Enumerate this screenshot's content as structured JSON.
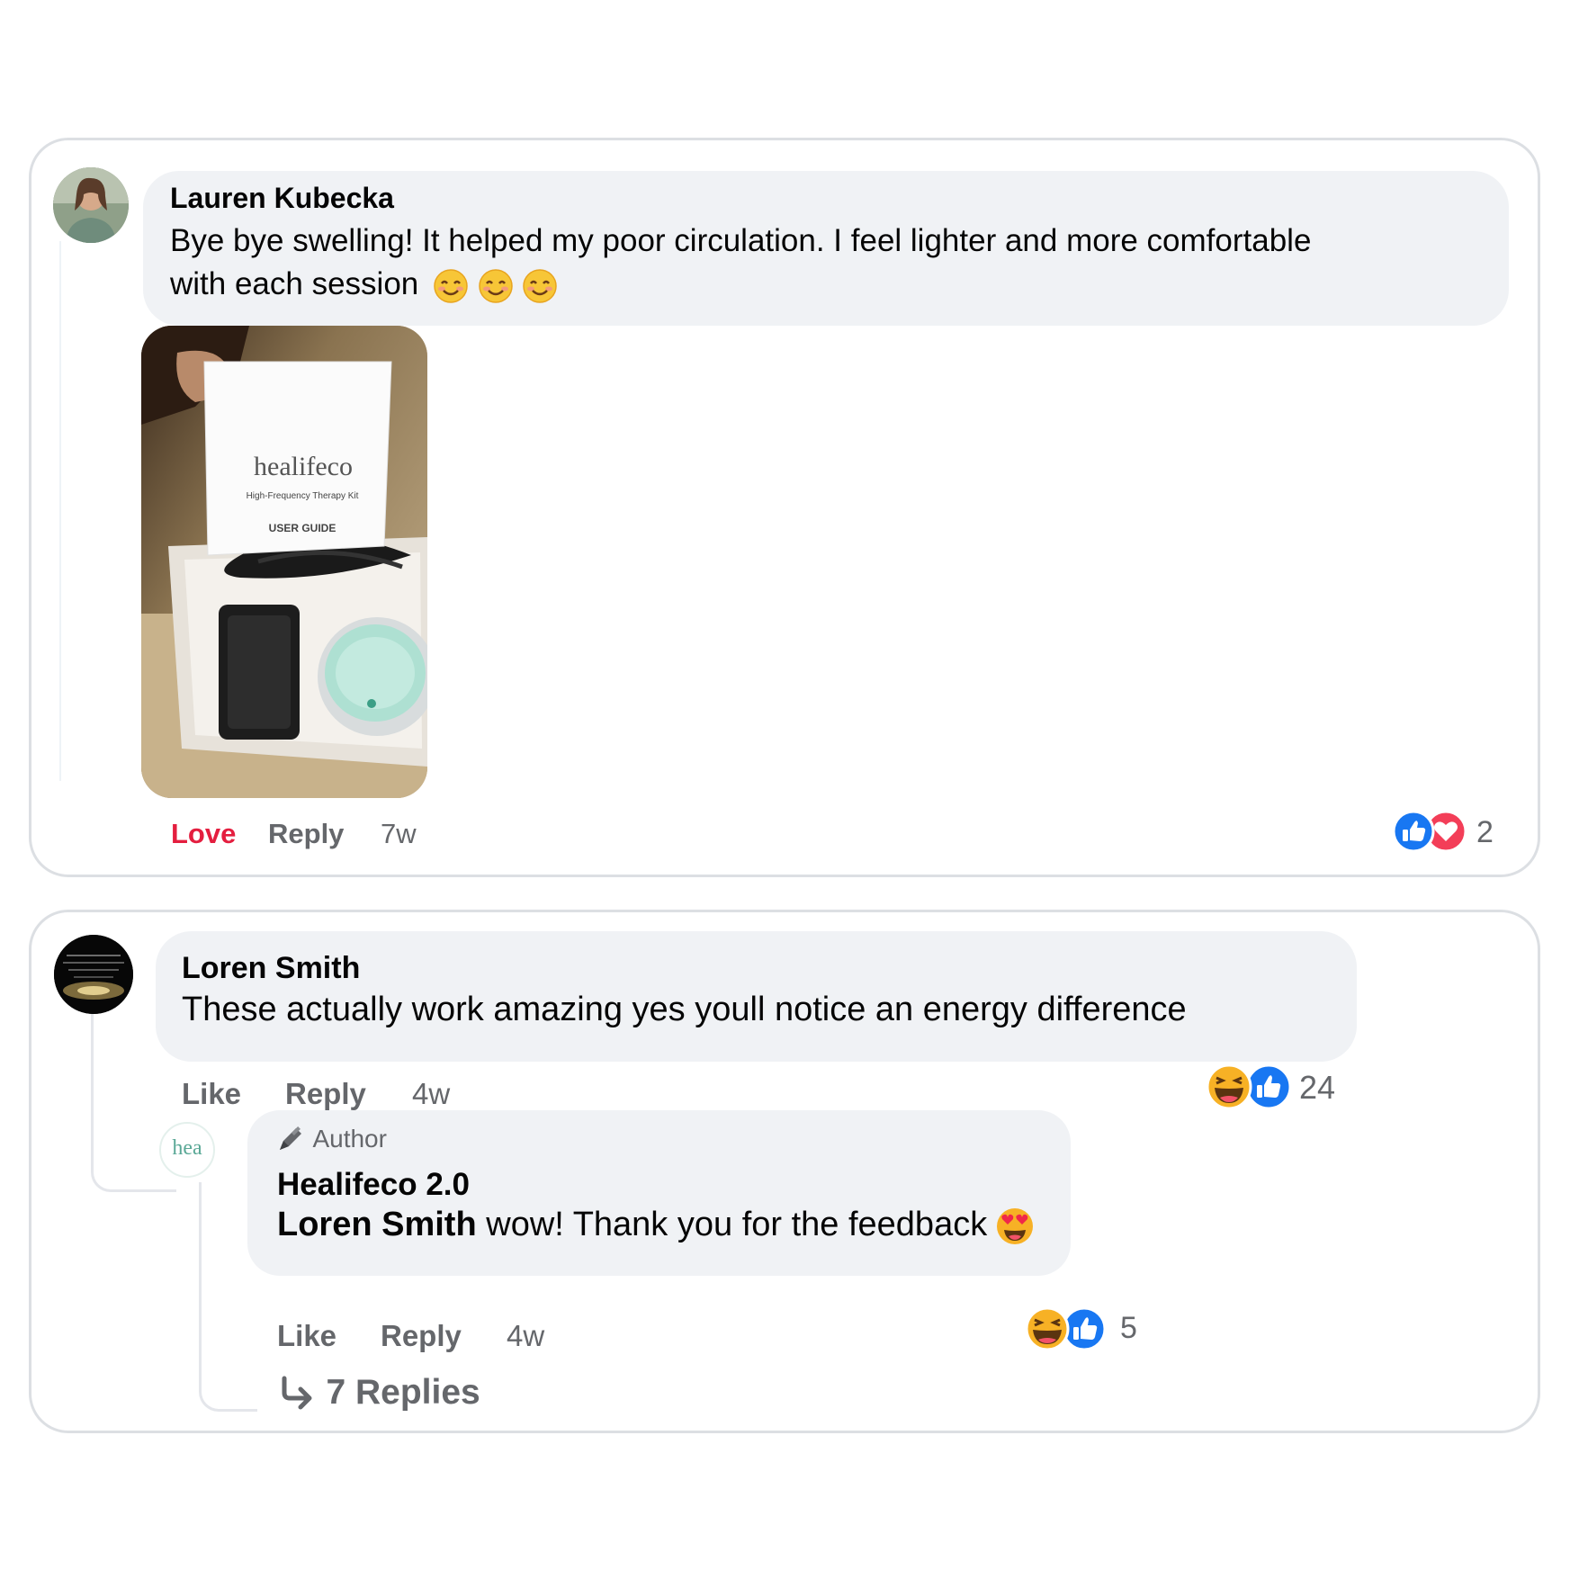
{
  "comment1": {
    "author": "Lauren Kubecka",
    "text_line1": "Bye bye swelling! It helped my poor circulation. I feel lighter and more comfortable",
    "text_line2": "with each session",
    "photo": {
      "brand": "healifeco",
      "subtitle": "High-Frequency Therapy Kit",
      "guide": "USER GUIDE"
    },
    "actions": {
      "love": "Love",
      "reply": "Reply",
      "time": "7w"
    },
    "reactions": {
      "icons": [
        "like-icon",
        "love-icon"
      ],
      "count": "2"
    },
    "colors": {
      "love_red": "#e41e3f",
      "like_blue": "#1877f2"
    }
  },
  "comment2": {
    "author": "Loren Smith",
    "text": "These actually work amazing yes youll notice an energy difference",
    "actions": {
      "like": "Like",
      "reply": "Reply",
      "time": "4w"
    },
    "reactions": {
      "icons": [
        "haha-icon",
        "like-icon"
      ],
      "count": "24"
    }
  },
  "reply": {
    "avatar_text": "hea",
    "badge": "Author",
    "author": "Healifeco 2.0",
    "mention": "Loren Smith",
    "text": " wow! Thank you for the feedback",
    "actions": {
      "like": "Like",
      "reply": "Reply",
      "time": "4w"
    },
    "reactions": {
      "icons": [
        "haha-icon",
        "like-icon"
      ],
      "count": "5"
    },
    "more_replies": "7 Replies"
  }
}
